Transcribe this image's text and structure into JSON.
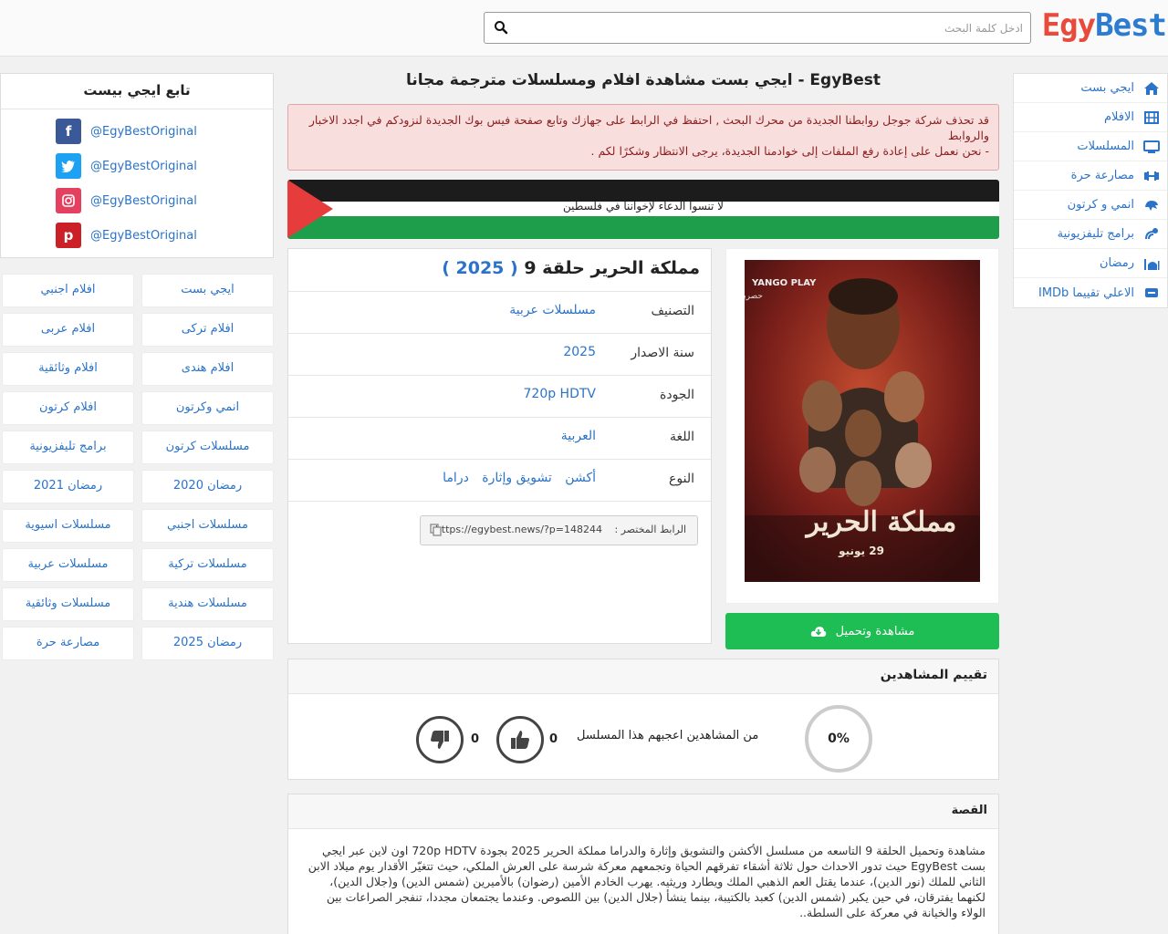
{
  "header": {
    "logo_egy": "Egy",
    "logo_best": "Best",
    "search_placeholder": "ادخل كلمة البحث"
  },
  "nav": {
    "items": [
      {
        "label": "ايجي بست",
        "icon": "home-icon"
      },
      {
        "label": "الافلام",
        "icon": "film-icon"
      },
      {
        "label": "المسلسلات",
        "icon": "tv-icon"
      },
      {
        "label": "مصارعة حرة",
        "icon": "dumbbell-icon"
      },
      {
        "label": "انمي و كرتون",
        "icon": "dragon-icon"
      },
      {
        "label": "برامج تليفزيونية",
        "icon": "satellite-icon"
      },
      {
        "label": "رمضان",
        "icon": "mosque-icon"
      },
      {
        "label": "الاعلي تقييما IMDb",
        "icon": "imdb-icon"
      }
    ]
  },
  "follow": {
    "title": "تابع ايجي بيست",
    "accounts": [
      {
        "network": "facebook",
        "handle": "@EgyBestOriginal",
        "color": "#3b5998"
      },
      {
        "network": "twitter",
        "handle": "@EgyBestOriginal",
        "color": "#1da1f2"
      },
      {
        "network": "instagram",
        "handle": "@EgyBestOriginal",
        "color": "#e4405f"
      },
      {
        "network": "pinterest",
        "handle": "@EgyBestOriginal",
        "color": "#cb2027"
      }
    ]
  },
  "categories": [
    "ايجي بست",
    "افلام اجنبي",
    "افلام تركى",
    "افلام عربى",
    "افلام هندى",
    "افلام وثائقية",
    "انمي وكرتون",
    "افلام كرتون",
    "مسلسلات كرتون",
    "برامج تليفزيونية",
    "رمضان 2020",
    "رمضان 2021",
    "مسلسلات اجنبي",
    "مسلسلات اسيوية",
    "مسلسلات تركية",
    "مسلسلات عربية",
    "مسلسلات هندية",
    "مسلسلات وثائقية",
    "رمضان 2025",
    "مصارعة حرة"
  ],
  "page": {
    "title": "EgyBest - ايجي بست مشاهدة افلام ومسلسلات مترجمة مجانا",
    "alert_line1": "قد تحذف شركة جوجل روابطنا الجديدة من محرك البحث , احتفظ في الرابط على جهازك وتابع صفحة فيس بوك الجديدة لنزودكم في اجدد الاخبار والروابط",
    "alert_line2": "- نحن نعمل على إعادة رفع الملفات إلى خوادمنا الجديدة، يرجى الانتظار وشكرًا لكم .",
    "banner_text": "لا تنسوا الدعاء لإخواننا في فلسطين"
  },
  "show": {
    "title": "مملكة الحرير حلقة 9",
    "year": "2025",
    "fields": [
      {
        "key": "التصنيف",
        "values": [
          "مسلسلات عربية"
        ]
      },
      {
        "key": "سنة الاصدار",
        "values": [
          "2025"
        ]
      },
      {
        "key": "الجودة",
        "values": [
          "720p HDTV"
        ]
      },
      {
        "key": "اللغة",
        "values": [
          "العربية"
        ]
      },
      {
        "key": "النوع",
        "values": [
          "أكشن",
          "تشويق وإثارة",
          "دراما"
        ]
      }
    ],
    "shortlink_label": "الرابط المختصر :",
    "shortlink_url": "https://egybest.news/?p=148244",
    "poster_title": "مملكة الحرير",
    "poster_date": "29 يونيو",
    "poster_brand": "YANGO PLAY",
    "poster_brand_sub": "حصريا",
    "watch_button": "مشاهدة وتحميل"
  },
  "rating": {
    "title": "تقييم المشاهدين",
    "percent": "0%",
    "liked_text": "من المشاهدين اعجبهم هذا المسلسل",
    "likes": "0",
    "dislikes": "0"
  },
  "story": {
    "title": "القصة",
    "text": "مشاهدة وتحميل الحلقة 9 التاسعه من مسلسل الأكشن والتشويق وإثارة والدراما مملكة الحرير 2025 بجودة 720p HDTV اون لاين عبر ايجي بست EgyBest حيث تدور الاحداث حول ثلاثة أشقاء تفرقهم الحياة وتجمعهم معركة شرسة على العرش الملكي، حيث تتغيّر الأقدار يوم ميلاد الابن الثاني للملك (نور الدين)، عندما يقتل العم الذهبي الملك ويطارد وريثيه. يهرب الخادم الأمين (رضوان) بالأميرين (شمس الدين) و(جلال الدين)، لكنهما يفترقان، في حين يكبر (شمس الدين) كعبد بالكتيبة، بينما ينشأ (جلال الدين) بين اللصوص. وعندما يجتمعان مجددا، تنفجر الصراعات بين الولاء والخيانة في معركة على السلطة.."
  }
}
